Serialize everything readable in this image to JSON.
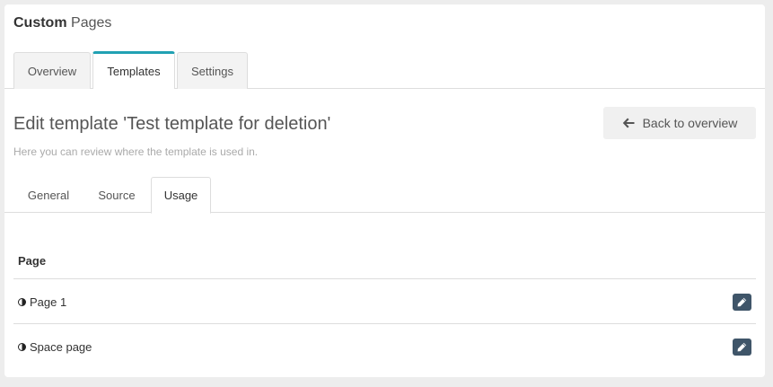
{
  "header": {
    "title_bold": "Custom",
    "title_light": "Pages"
  },
  "top_tabs": [
    {
      "label": "Overview",
      "active": false
    },
    {
      "label": "Templates",
      "active": true
    },
    {
      "label": "Settings",
      "active": false
    }
  ],
  "edit": {
    "title": "Edit template 'Test template for deletion'",
    "subtitle": "Here you can review where the template is used in.",
    "back_label": "Back to overview"
  },
  "sub_tabs": [
    {
      "label": "General",
      "active": false
    },
    {
      "label": "Source",
      "active": false
    },
    {
      "label": "Usage",
      "active": true
    }
  ],
  "table": {
    "column": "Page",
    "rows": [
      {
        "name": "Page 1",
        "icon": "half-circle-icon"
      },
      {
        "name": "Space page",
        "icon": "half-circle-icon"
      }
    ]
  },
  "colors": {
    "accent": "#21a1b3",
    "edit_button": "#3f5569"
  }
}
